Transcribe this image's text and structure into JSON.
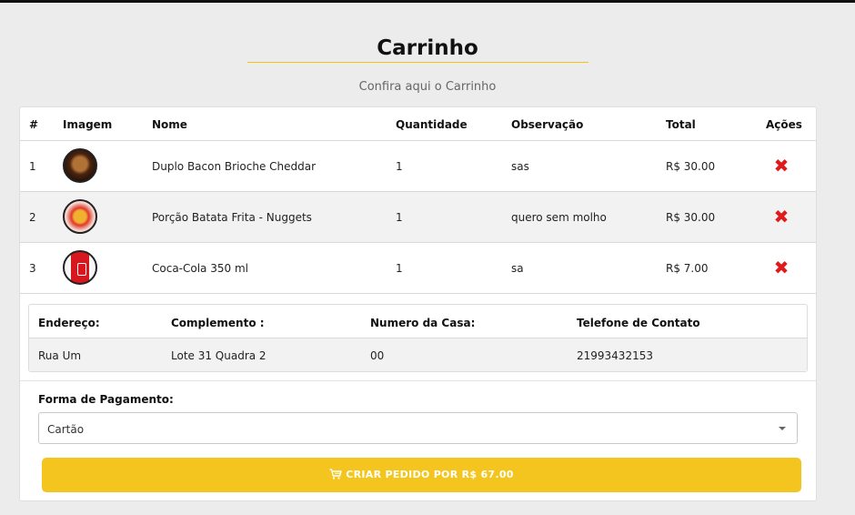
{
  "page": {
    "title": "Carrinho",
    "subtitle": "Confira aqui o Carrinho"
  },
  "colors": {
    "accent": "#f4c51f",
    "delete": "#e01b1b",
    "background": "#ececec"
  },
  "cart": {
    "headers": {
      "index": "#",
      "image": "Imagem",
      "name": "Nome",
      "quantity": "Quantidade",
      "note": "Observação",
      "total": "Total",
      "actions": "Ações"
    },
    "items": [
      {
        "index": "1",
        "image_icon": "burger-image",
        "name": "Duplo Bacon Brioche Cheddar",
        "quantity": "1",
        "note": "sas",
        "total": "R$ 30.00",
        "action_icon": "delete-icon"
      },
      {
        "index": "2",
        "image_icon": "fries-image",
        "name": "Porção Batata Frita - Nuggets",
        "quantity": "1",
        "note": "quero sem molho",
        "total": "R$ 30.00",
        "action_icon": "delete-icon"
      },
      {
        "index": "3",
        "image_icon": "coke-image",
        "name": "Coca-Cola 350 ml",
        "quantity": "1",
        "note": "sa",
        "total": "R$ 7.00",
        "action_icon": "delete-icon"
      }
    ]
  },
  "address": {
    "headers": {
      "street": "Endereço:",
      "complement": "Complemento :",
      "number": "Numero da Casa:",
      "phone": "Telefone de Contato"
    },
    "values": {
      "street": "Rua Um",
      "complement": "Lote 31 Quadra 2",
      "number": "00",
      "phone": "21993432153"
    }
  },
  "payment": {
    "label": "Forma de Pagamento:",
    "selected": "Cartão"
  },
  "order_button": {
    "label": "CRIAR PEDIDO POR R$ 67.00",
    "icon": "cart-icon"
  }
}
